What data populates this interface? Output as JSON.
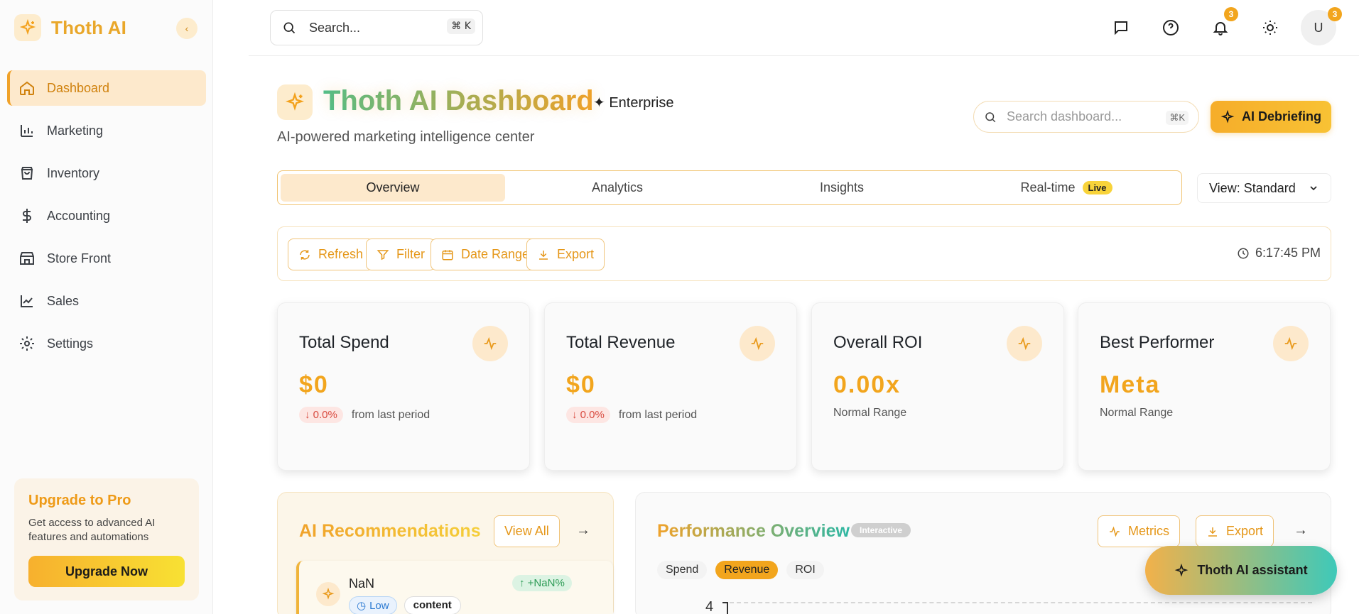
{
  "sidebar": {
    "brand": "Thoth AI",
    "items": [
      {
        "label": "Dashboard"
      },
      {
        "label": "Marketing"
      },
      {
        "label": "Inventory"
      },
      {
        "label": "Accounting"
      },
      {
        "label": "Store Front"
      },
      {
        "label": "Sales"
      },
      {
        "label": "Settings"
      }
    ],
    "upgrade": {
      "title": "Upgrade to Pro",
      "desc": "Get access to advanced AI features and automations",
      "button": "Upgrade Now"
    }
  },
  "topbar": {
    "search_placeholder": "Search...",
    "shortcut": "⌘ K",
    "notification_count": "3",
    "avatar_initial": "U",
    "avatar_badge": "3"
  },
  "header": {
    "title": "Thoth AI Dashboard",
    "tier": "Enterprise",
    "subtitle": "AI-powered marketing intelligence center",
    "search_placeholder": "Search dashboard...",
    "search_shortcut": "⌘K",
    "debrief_button": "AI Debriefing"
  },
  "tabs": [
    {
      "label": "Overview"
    },
    {
      "label": "Analytics"
    },
    {
      "label": "Insights"
    },
    {
      "label": "Real-time",
      "badge": "Live"
    }
  ],
  "view_select": "View: Standard",
  "actions": {
    "refresh": "Refresh",
    "filter": "Filter",
    "date_range": "Date Range",
    "export": "Export",
    "time": "6:17:45 PM"
  },
  "metrics": [
    {
      "title": "Total Spend",
      "value": "$0",
      "change": "0.0%",
      "note": "from last period"
    },
    {
      "title": "Total Revenue",
      "value": "$0",
      "change": "0.0%",
      "note": "from last period"
    },
    {
      "title": "Overall ROI",
      "value": "0.00x",
      "note": "Normal Range"
    },
    {
      "title": "Best Performer",
      "value": "Meta",
      "note": "Normal Range"
    }
  ],
  "recommendations": {
    "title": "AI Recommendations",
    "view_all": "View All",
    "item": {
      "name": "NaN",
      "priority": "Low",
      "category": "content",
      "delta": "+NaN%"
    }
  },
  "performance": {
    "title": "Performance Overview",
    "tag": "Interactive",
    "metrics_button": "Metrics",
    "export_button": "Export",
    "segments": [
      "Spend",
      "Revenue",
      "ROI"
    ],
    "active_segment": "Revenue",
    "y_tick": "4"
  },
  "assistant": {
    "label": "Thoth AI assistant"
  },
  "colors": {
    "accent": "#f2a51d",
    "teal": "#3ec9b9",
    "active_bg": "#fde9cc"
  }
}
